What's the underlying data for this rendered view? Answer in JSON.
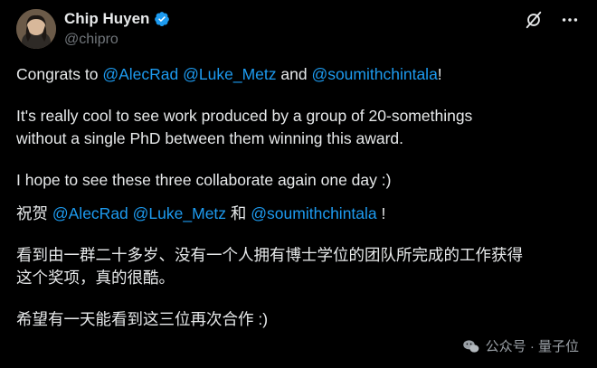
{
  "header": {
    "display_name": "Chip Huyen",
    "handle": "@chipro",
    "icons": [
      "avatar",
      "verified-badge-icon",
      "grok-icon",
      "more-icon"
    ],
    "more_label": "···"
  },
  "tweet": {
    "line1": {
      "pre": "Congrats to ",
      "m1": "@AlecRad",
      "s1": " ",
      "m2": "@Luke_Metz",
      "s2": " and ",
      "m3": "@soumithchintala",
      "post": "!"
    },
    "para2_line1": "It's really cool to see work produced by a group of 20-somethings",
    "para2_line2": "without a single PhD between them winning this award.",
    "para3": "I hope to see these three collaborate again one day :)",
    "zh_line1": {
      "pre": "祝贺 ",
      "m1": "@AlecRad",
      "s1": " ",
      "m2": "@Luke_Metz",
      "s2": " 和 ",
      "m3": "@soumithchintala",
      "post": " !"
    },
    "zh_para2_line1": "看到由一群二十多岁、没有一个人拥有博士学位的团队所完成的工作获得",
    "zh_para2_line2": "这个奖项，真的很酷。",
    "zh_para3": "希望有一天能看到这三位再次合作 :)"
  },
  "watermark": {
    "text": "公众号 · 量子位"
  },
  "colors": {
    "background": "#000000",
    "text": "#e7e9ea",
    "secondary": "#71767b",
    "mention": "#1d9bf0",
    "verified": "#1d9bf0"
  }
}
